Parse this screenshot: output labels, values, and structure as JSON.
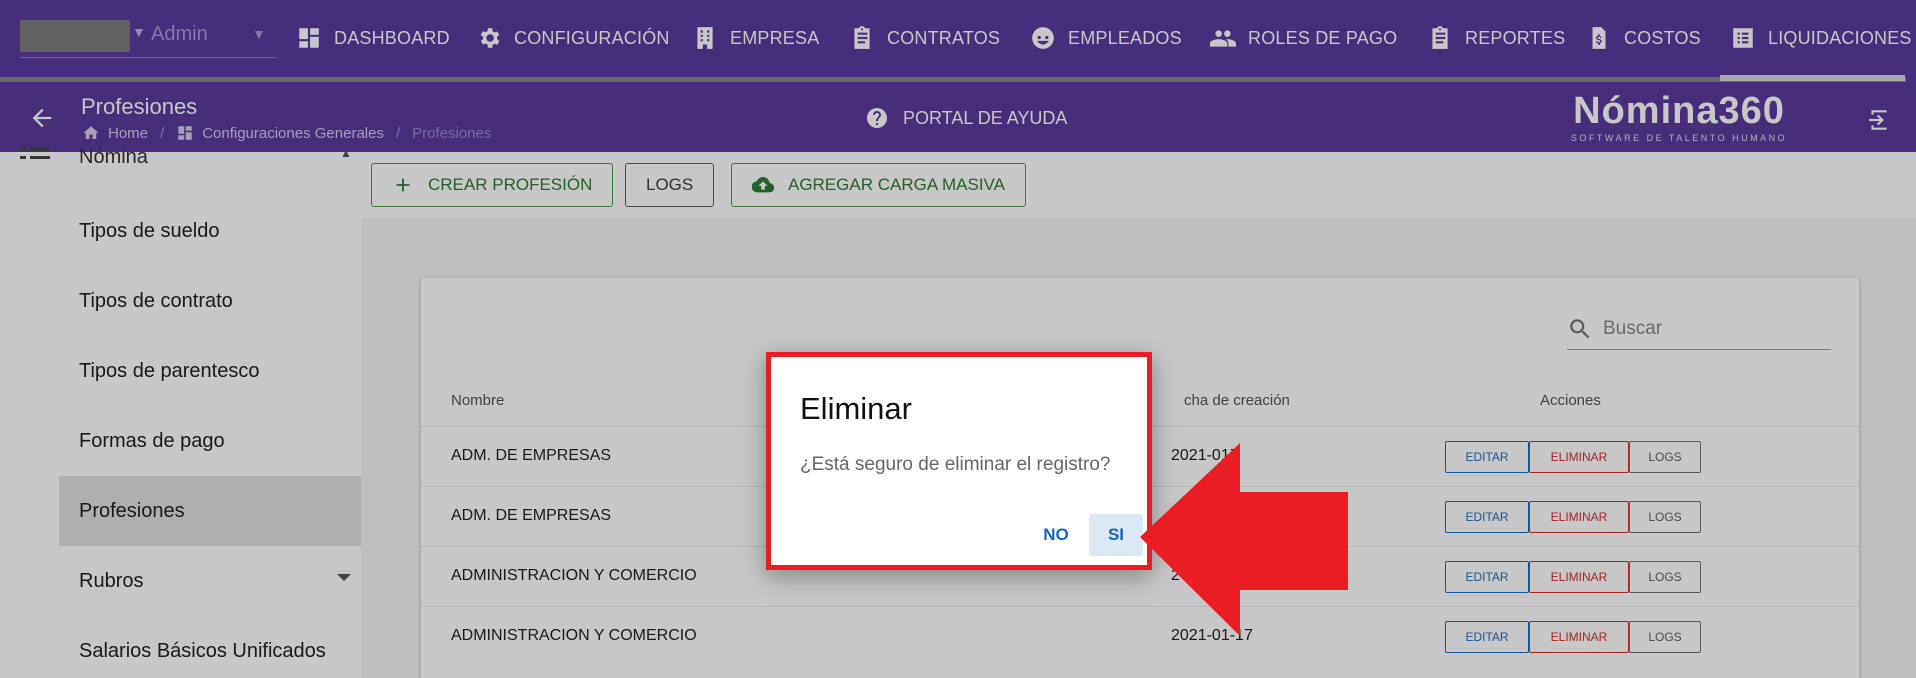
{
  "topnav": {
    "user_label": "Admin",
    "items": [
      {
        "label": "DASHBOARD",
        "icon": "dashboard-icon"
      },
      {
        "label": "CONFIGURACIÓN",
        "icon": "gear-icon"
      },
      {
        "label": "EMPRESA",
        "icon": "building-icon"
      },
      {
        "label": "CONTRATOS",
        "icon": "clipboard-icon"
      },
      {
        "label": "EMPLEADOS",
        "icon": "face-icon"
      },
      {
        "label": "ROLES DE PAGO",
        "icon": "people-icon"
      },
      {
        "label": "REPORTES",
        "icon": "clipboard-icon"
      },
      {
        "label": "COSTOS",
        "icon": "file-dollar-icon"
      },
      {
        "label": "LIQUIDACIONES",
        "icon": "list-icon"
      }
    ]
  },
  "subheader": {
    "title": "Profesiones",
    "breadcrumb": [
      "Home",
      "Configuraciones Generales",
      "Profesiones"
    ],
    "help_label": "PORTAL DE AYUDA",
    "brand_name": "Nómina360",
    "brand_tagline": "SOFTWARE DE TALENTO HUMANO"
  },
  "sidebar": {
    "parent_label": "Nómina",
    "items": [
      {
        "label": "Tipos de sueldo"
      },
      {
        "label": "Tipos de contrato"
      },
      {
        "label": "Tipos de parentesco"
      },
      {
        "label": "Formas de pago"
      },
      {
        "label": "Profesiones",
        "active": true
      },
      {
        "label": "Rubros",
        "expandable": true
      },
      {
        "label": "Salarios Básicos Unificados"
      }
    ]
  },
  "toolbar": {
    "create_label": "CREAR PROFESIÓN",
    "logs_label": "LOGS",
    "bulk_label": "AGREGAR CARGA MASIVA"
  },
  "search": {
    "placeholder": "Buscar"
  },
  "table": {
    "columns": [
      "Nombre",
      "cha de creación",
      "Acciones"
    ],
    "rows": [
      {
        "name": "ADM. DE EMPRESAS",
        "date": "2021-0‌‌17"
      },
      {
        "name": "ADM. DE EMPRESAS",
        "date": ""
      },
      {
        "name": "ADMINISTRACION Y COMERCIO",
        "date": "2"
      },
      {
        "name": "ADMINISTRACION Y COMERCIO",
        "date": "2021-01-17"
      }
    ],
    "actions": {
      "edit": "EDITAR",
      "delete": "ELIMINAR",
      "logs": "LOGS"
    }
  },
  "dialog": {
    "title": "Eliminar",
    "message": "¿Está seguro de eliminar el registro?",
    "no_label": "NO",
    "yes_label": "SI"
  },
  "colors": {
    "nav_purple": "#5a3c9f",
    "highlight_red": "#ea1c24",
    "action_blue": "#1e6fc0",
    "create_green": "#2e7d32"
  }
}
